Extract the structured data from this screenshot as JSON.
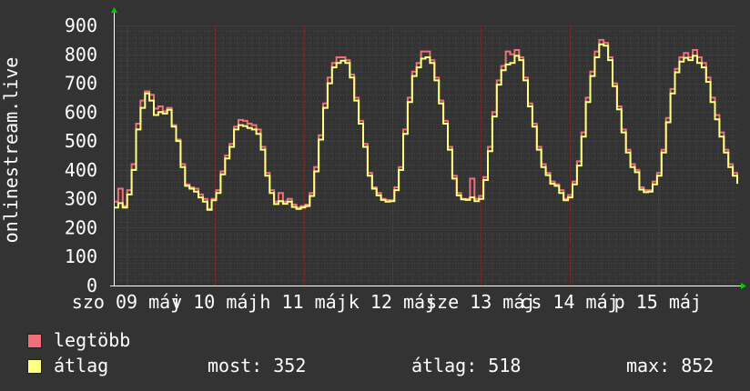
{
  "chart_data": {
    "type": "line",
    "ylabel": "onlinestream.live",
    "ylim": [
      0,
      900
    ],
    "yticks": [
      0,
      100,
      200,
      300,
      400,
      500,
      600,
      700,
      800,
      900
    ],
    "xticks": [
      "szo 09 máj",
      "v 10 máj",
      "h 11 máj",
      "k 12 máj",
      "sze 13 máj",
      "cs 14 máj",
      "p 15 máj"
    ],
    "grid": true,
    "legend_position": "bottom-left",
    "series": [
      {
        "name": "legtöbb",
        "color": "#f07078",
        "values": [
          290,
          335,
          275,
          330,
          420,
          560,
          640,
          672,
          660,
          612,
          620,
          603,
          615,
          555,
          505,
          420,
          350,
          340,
          335,
          315,
          300,
          265,
          300,
          330,
          395,
          450,
          490,
          550,
          573,
          570,
          560,
          555,
          540,
          480,
          390,
          330,
          290,
          320,
          290,
          300,
          280,
          270,
          275,
          280,
          320,
          410,
          520,
          630,
          720,
          770,
          790,
          790,
          780,
          730,
          650,
          570,
          490,
          390,
          340,
          320,
          300,
          296,
          295,
          340,
          410,
          540,
          650,
          740,
          770,
          810,
          810,
          780,
          720,
          640,
          570,
          480,
          380,
          320,
          300,
          300,
          370,
          300,
          310,
          375,
          480,
          600,
          710,
          760,
          810,
          800,
          815,
          790,
          720,
          630,
          560,
          480,
          420,
          390,
          360,
          350,
          330,
          300,
          313,
          360,
          430,
          530,
          650,
          740,
          810,
          850,
          840,
          790,
          700,
          620,
          540,
          470,
          420,
          400,
          340,
          330,
          330,
          360,
          390,
          470,
          580,
          680,
          750,
          790,
          805,
          790,
          815,
          790,
          770,
          720,
          650,
          590,
          530,
          470,
          420,
          390,
          360
        ]
      },
      {
        "name": "átlag",
        "color": "#ffff80",
        "values": [
          270,
          285,
          270,
          315,
          400,
          540,
          615,
          665,
          640,
          590,
          600,
          595,
          608,
          550,
          500,
          410,
          345,
          335,
          325,
          305,
          290,
          262,
          295,
          320,
          385,
          440,
          480,
          540,
          555,
          552,
          545,
          540,
          525,
          470,
          380,
          320,
          282,
          292,
          283,
          290,
          272,
          265,
          270,
          275,
          310,
          395,
          505,
          615,
          700,
          755,
          770,
          778,
          770,
          720,
          640,
          560,
          480,
          380,
          335,
          312,
          296,
          290,
          292,
          330,
          400,
          525,
          635,
          725,
          755,
          785,
          790,
          770,
          710,
          630,
          560,
          470,
          370,
          312,
          298,
          296,
          305,
          292,
          300,
          365,
          465,
          585,
          695,
          745,
          765,
          770,
          795,
          780,
          710,
          620,
          550,
          470,
          410,
          382,
          352,
          345,
          320,
          295,
          305,
          350,
          415,
          515,
          635,
          725,
          790,
          835,
          830,
          780,
          690,
          610,
          530,
          460,
          410,
          392,
          332,
          323,
          325,
          350,
          380,
          460,
          565,
          665,
          738,
          775,
          788,
          780,
          795,
          770,
          755,
          705,
          635,
          575,
          515,
          460,
          410,
          380,
          352
        ]
      }
    ],
    "stats": [
      {
        "label": "most:",
        "value": "352"
      },
      {
        "label": "átlag:",
        "value": "518"
      },
      {
        "label": "max:",
        "value": "852"
      }
    ]
  }
}
